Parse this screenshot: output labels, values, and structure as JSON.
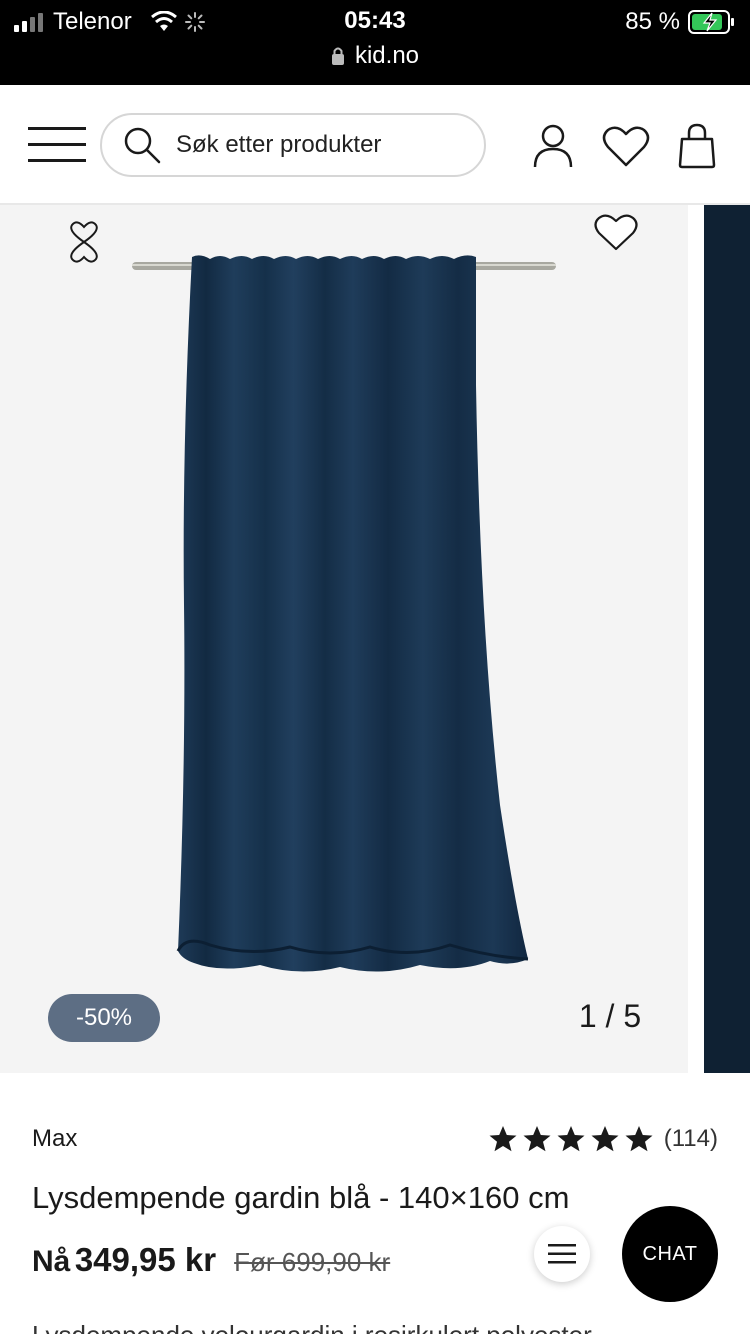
{
  "status_bar": {
    "carrier": "Telenor",
    "time": "05:43",
    "url": "kid.no",
    "battery_percent": "85 %"
  },
  "header": {
    "search_placeholder": "Søk etter produkter"
  },
  "gallery": {
    "discount": "-50%",
    "counter": "1 / 5"
  },
  "product": {
    "brand": "Max",
    "rating_stars": 5,
    "review_count": "(114)",
    "title": "Lysdempende gardin blå - 140×160 cm",
    "price_now_label": "Nå",
    "price_now": "349,95 kr",
    "price_before": "Før 699,90 kr",
    "description": "Lysdempende velourgardin i resirkulert polyester"
  },
  "chat": {
    "label": "CHAT"
  },
  "colors": {
    "badge": "#5d6e84",
    "curtain": "#1b3550",
    "chat_bg": "#000000"
  }
}
